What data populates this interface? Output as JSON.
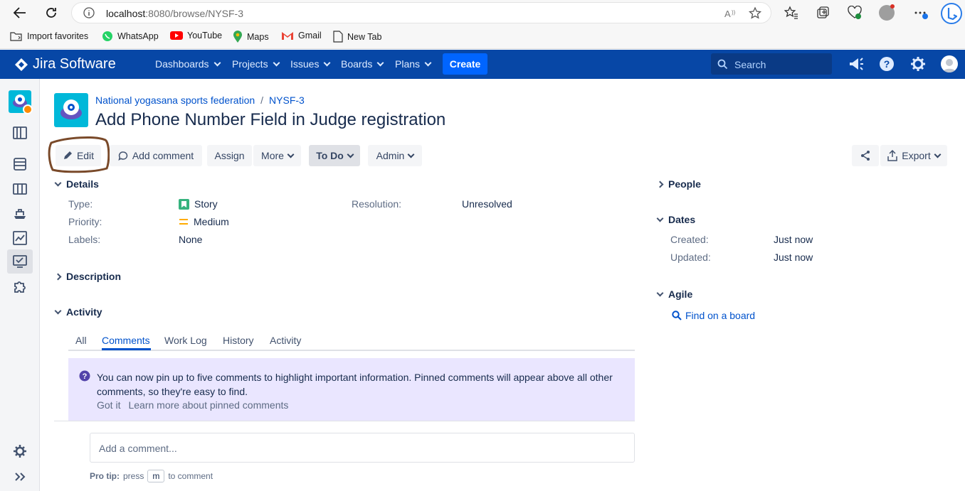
{
  "browser": {
    "url_host": "localhost",
    "url_path": ":8080/browse/NYSF-3",
    "bookmarks": [
      "Import favorites",
      "WhatsApp",
      "YouTube",
      "Maps",
      "Gmail",
      "New Tab"
    ]
  },
  "nav": {
    "brand": "Jira Software",
    "items": [
      "Dashboards",
      "Projects",
      "Issues",
      "Boards",
      "Plans"
    ],
    "create": "Create",
    "search_placeholder": "Search"
  },
  "issue": {
    "project": "National yogasana sports federation",
    "separator": "/",
    "key": "NYSF-3",
    "title": "Add Phone Number Field in Judge registration"
  },
  "toolbar": {
    "edit": "Edit",
    "add_comment": "Add comment",
    "assign": "Assign",
    "more": "More",
    "status": "To Do",
    "admin": "Admin",
    "export": "Export"
  },
  "details": {
    "heading": "Details",
    "type_label": "Type:",
    "type_value": "Story",
    "priority_label": "Priority:",
    "priority_value": "Medium",
    "labels_label": "Labels:",
    "labels_value": "None",
    "resolution_label": "Resolution:",
    "resolution_value": "Unresolved"
  },
  "description": {
    "heading": "Description"
  },
  "activity": {
    "heading": "Activity",
    "tabs": [
      "All",
      "Comments",
      "Work Log",
      "History",
      "Activity"
    ],
    "active_tab": "Comments",
    "notice": "You can now pin up to five comments to highlight important information. Pinned comments will appear above all other comments, so they're easy to find.",
    "got_it": "Got it",
    "learn_more": "Learn more about pinned comments",
    "comment_placeholder": "Add a comment...",
    "protip_bold": "Pro tip:",
    "protip_press": "press",
    "protip_key": "m",
    "protip_rest": "to comment"
  },
  "people": {
    "heading": "People"
  },
  "dates": {
    "heading": "Dates",
    "created_label": "Created:",
    "created_value": "Just now",
    "updated_label": "Updated:",
    "updated_value": "Just now"
  },
  "agile": {
    "heading": "Agile",
    "find_board": "Find on a board"
  },
  "colors": {
    "nav": "#0747a6",
    "create": "#0065ff",
    "link": "#0052cc",
    "notice_bg": "#eae6ff",
    "annotation": "#7a4a2a"
  }
}
